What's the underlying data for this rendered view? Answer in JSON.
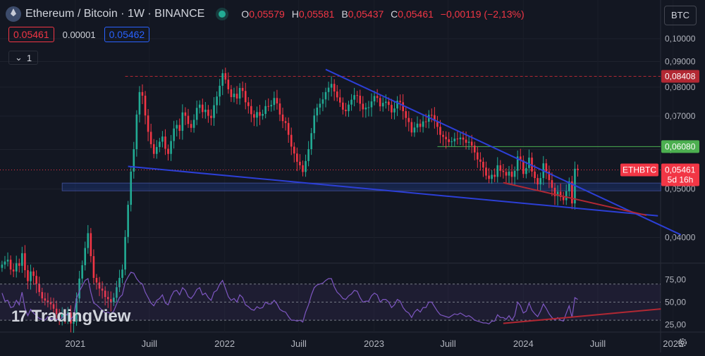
{
  "header": {
    "pair": "Ethereum / Bitcoin · 1W · BINANCE",
    "o_label": "O",
    "o_value": "0,05579",
    "h_label": "H",
    "h_value": "0,05581",
    "b_label": "B",
    "b_value": "0,05437",
    "c_label": "C",
    "c_value": "0,05461",
    "change": "−0,00119 (−2,13%)",
    "sell_price": "0.05461",
    "spread": "0.00001",
    "buy_price": "0.05462",
    "indicator_count": "1",
    "currency": "BTC"
  },
  "branding": {
    "name": "TradingView"
  },
  "colors": {
    "background": "#131722",
    "up": "#22ab94",
    "down": "#f23645",
    "trendline": "#2c3fd6",
    "support_red": "#b22833",
    "rsi_line": "#7e57c2",
    "resistance_dashed": "#b22833",
    "resistance_green": "#4caf50"
  },
  "chart_data": [
    {
      "type": "candlestick",
      "symbol": "ETHBTC",
      "timeframe": "1W",
      "last": 0.05461,
      "countdown": "5d 16h",
      "ylim": [
        0.036,
        0.105
      ],
      "y_scale": "log",
      "y_ticks": [
        0.1,
        0.09,
        0.08,
        0.07,
        0.06,
        0.05,
        0.04
      ],
      "y_tick_labels": [
        "0,10000",
        "0,09000",
        "0,08000",
        "0,07000",
        "0,06000",
        "0,05000",
        "0,04000"
      ],
      "x_ticks": [
        "2021-01-01",
        "2021-07-01",
        "2022-01-01",
        "2022-07-01",
        "2023-01-01",
        "2023-07-01",
        "2024-01-01",
        "2024-07-01",
        "2025-01-01"
      ],
      "x_tick_labels": [
        "2021",
        "Juill",
        "2022",
        "Juill",
        "2023",
        "Juill",
        "2024",
        "Juill",
        "2025"
      ],
      "xlim": [
        "2020-07-01",
        "2025-03-20"
      ],
      "price_labels": [
        {
          "text": "0,08408",
          "value": 0.08408,
          "color": "#b22833"
        },
        {
          "text": "0,06080",
          "value": 0.0608,
          "color": "#4caf50"
        },
        {
          "text": "0,05461",
          "value": 0.05461,
          "color": "#f23645"
        }
      ],
      "symbol_tag": "ETHBTC",
      "closes": [
        0.0353,
        0.0358,
        0.0361,
        0.0345,
        0.0342,
        0.0355,
        0.0351,
        0.0372,
        0.0344,
        0.0327,
        0.0342,
        0.0335,
        0.0323,
        0.0311,
        0.0302,
        0.0299,
        0.0297,
        0.0294,
        0.0288,
        0.0281,
        0.0276,
        0.0281,
        0.0279,
        0.0283,
        0.0269,
        0.0271,
        0.0302,
        0.0331,
        0.0352,
        0.0381,
        0.0408,
        0.0367,
        0.0332,
        0.0325,
        0.0316,
        0.0313,
        0.0304,
        0.0301,
        0.0297,
        0.0303,
        0.0318,
        0.0332,
        0.0345,
        0.0401,
        0.0465,
        0.0542,
        0.0601,
        0.0705,
        0.0782,
        0.0769,
        0.0702,
        0.0651,
        0.0615,
        0.0588,
        0.0607,
        0.0622,
        0.0637,
        0.0602,
        0.0588,
        0.0624,
        0.0661,
        0.0672,
        0.0654,
        0.0712,
        0.0701,
        0.0675,
        0.0663,
        0.0688,
        0.0727,
        0.0738,
        0.0713,
        0.0721,
        0.0701,
        0.0694,
        0.0736,
        0.0766,
        0.0805,
        0.0853,
        0.0828,
        0.0792,
        0.0764,
        0.0776,
        0.0759,
        0.0797,
        0.0786,
        0.0746,
        0.0733,
        0.0706,
        0.0695,
        0.0713,
        0.0701,
        0.0707,
        0.0733,
        0.0732,
        0.0737,
        0.0761,
        0.0742,
        0.0705,
        0.0684,
        0.0678,
        0.0642,
        0.0608,
        0.0589,
        0.0567,
        0.0558,
        0.0541,
        0.0569,
        0.0601,
        0.0647,
        0.0702,
        0.0728,
        0.0741,
        0.0756,
        0.0782,
        0.0798,
        0.0812,
        0.0784,
        0.0763,
        0.0745,
        0.0721,
        0.0716,
        0.0738,
        0.0755,
        0.0771,
        0.0769,
        0.0741,
        0.0722,
        0.0728,
        0.0729,
        0.0749,
        0.0768,
        0.0761,
        0.0732,
        0.0744,
        0.0748,
        0.0737,
        0.0712,
        0.0725,
        0.0751,
        0.0746,
        0.0716,
        0.0694,
        0.0681,
        0.0649,
        0.0664,
        0.0676,
        0.0666,
        0.0683,
        0.0682,
        0.0704,
        0.0703,
        0.0684,
        0.0666,
        0.0642,
        0.0636,
        0.0629,
        0.0621,
        0.0623,
        0.0631,
        0.0629,
        0.0634,
        0.0628,
        0.0619,
        0.0622,
        0.0611,
        0.0592,
        0.0573,
        0.0567,
        0.0552,
        0.0532,
        0.0524,
        0.0534,
        0.0529,
        0.0558,
        0.0544,
        0.0541,
        0.0532,
        0.0542,
        0.0529,
        0.0544,
        0.0581,
        0.0571,
        0.0536,
        0.0551,
        0.0578,
        0.0542,
        0.0526,
        0.0511,
        0.0526,
        0.0563,
        0.0542,
        0.0521,
        0.0503,
        0.0484,
        0.0494,
        0.0482,
        0.0475,
        0.0495,
        0.0518,
        0.0468,
        0.0549,
        0.0546
      ],
      "trendlines": [
        {
          "name": "falling-wedge-upper",
          "from": [
            "2022-09-05",
            0.0868
          ],
          "to": [
            "2025-01-20",
            0.0405
          ]
        },
        {
          "name": "falling-wedge-lower",
          "from": [
            "2021-05-10",
            0.0555
          ],
          "to": [
            "2024-11-25",
            0.0442
          ]
        },
        {
          "name": "support-red",
          "from": [
            "2023-11-13",
            0.0515
          ],
          "to": [
            "2024-10-28",
            0.0443
          ]
        }
      ],
      "hlines": [
        {
          "name": "resistance-dashed",
          "value": 0.08408,
          "from": "2021-05-03"
        },
        {
          "name": "resistance-green",
          "value": 0.0608,
          "from": "2023-06-05"
        },
        {
          "name": "last-price-dotted",
          "value": 0.05461,
          "from": "2020-07-01"
        }
      ],
      "zones": [
        {
          "name": "demand-zone",
          "from": [
            "2020-11-30",
            0.0496
          ],
          "to": [
            "2024-12-02",
            0.0514
          ]
        }
      ]
    },
    {
      "type": "line",
      "indicator": "RSI",
      "ylim": [
        20,
        90
      ],
      "y_ticks": [
        75,
        50,
        25
      ],
      "y_tick_labels": [
        "75,00",
        "50,00",
        "25,00"
      ],
      "bands": [
        30,
        70
      ],
      "values": [
        60,
        51,
        52,
        44,
        45,
        52,
        47,
        61,
        43,
        35,
        42,
        38,
        35,
        32,
        31,
        30,
        34,
        31,
        33,
        31,
        30,
        33,
        35,
        37,
        31,
        35,
        54,
        62,
        68,
        74,
        76,
        61,
        49,
        47,
        44,
        41,
        38,
        39,
        37,
        40,
        48,
        55,
        58,
        72,
        78,
        83,
        82,
        76,
        72,
        70,
        61,
        55,
        49,
        46,
        52,
        54,
        58,
        49,
        47,
        56,
        62,
        63,
        58,
        66,
        63,
        56,
        54,
        58,
        64,
        66,
        58,
        60,
        55,
        52,
        61,
        63,
        70,
        74,
        65,
        56,
        52,
        54,
        50,
        58,
        55,
        47,
        45,
        42,
        41,
        45,
        43,
        44,
        50,
        48,
        48,
        52,
        48,
        42,
        40,
        39,
        34,
        30,
        30,
        29,
        30,
        28,
        39,
        47,
        58,
        66,
        69,
        70,
        71,
        74,
        76,
        76,
        67,
        61,
        58,
        54,
        53,
        57,
        59,
        63,
        62,
        55,
        50,
        51,
        51,
        57,
        60,
        58,
        50,
        53,
        53,
        50,
        44,
        47,
        53,
        51,
        44,
        40,
        38,
        33,
        39,
        42,
        39,
        44,
        44,
        50,
        50,
        45,
        40,
        36,
        35,
        34,
        33,
        35,
        37,
        36,
        38,
        36,
        34,
        35,
        33,
        30,
        29,
        28,
        27,
        27,
        26,
        29,
        29,
        36,
        33,
        33,
        31,
        35,
        30,
        35,
        50,
        46,
        38,
        40,
        49,
        41,
        37,
        34,
        40,
        48,
        43,
        37,
        33,
        30,
        33,
        30,
        29,
        38,
        46,
        33,
        55,
        53
      ],
      "trendlines": [
        {
          "name": "rsi-support-red",
          "from": [
            "2023-11-13",
            26.5
          ],
          "to": [
            "2024-12-02",
            42.5
          ]
        }
      ]
    }
  ]
}
